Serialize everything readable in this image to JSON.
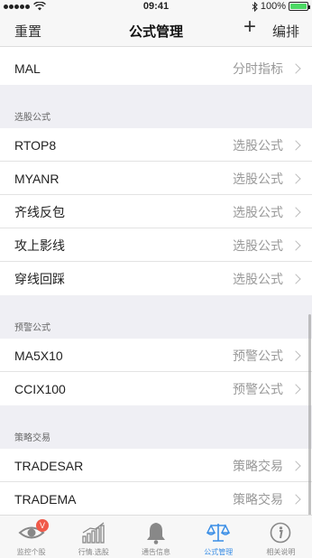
{
  "status": {
    "time": "09:41",
    "battery": "100%",
    "battery_level": 1.0
  },
  "nav": {
    "left": "重置",
    "title": "公式管理",
    "plus": "+",
    "right": "编排"
  },
  "top_row": {
    "name": "MAL",
    "type": "分时指标"
  },
  "sections": [
    {
      "header": "选股公式",
      "items": [
        {
          "name": "RTOP8",
          "type": "选股公式"
        },
        {
          "name": "MYANR",
          "type": "选股公式"
        },
        {
          "name": "齐线反包",
          "type": "选股公式"
        },
        {
          "name": "攻上影线",
          "type": "选股公式"
        },
        {
          "name": "穿线回踩",
          "type": "选股公式"
        }
      ]
    },
    {
      "header": "预警公式",
      "items": [
        {
          "name": "MA5X10",
          "type": "预警公式"
        },
        {
          "name": "CCIX100",
          "type": "预警公式"
        }
      ]
    },
    {
      "header": "策略交易",
      "items": [
        {
          "name": "TRADESAR",
          "type": "策略交易"
        },
        {
          "name": "TRADEMA",
          "type": "策略交易"
        }
      ]
    }
  ],
  "tabs": [
    {
      "label": "监控个股",
      "icon": "eye-icon",
      "badge": "V"
    },
    {
      "label": "行情.选股",
      "icon": "bar-chart-icon"
    },
    {
      "label": "通告信息",
      "icon": "bell-icon"
    },
    {
      "label": "公式管理",
      "icon": "formula-icon",
      "active": true
    },
    {
      "label": "相关说明",
      "icon": "info-icon"
    }
  ],
  "colors": {
    "accent": "#3a8ee6",
    "badge": "#f05a4a"
  }
}
